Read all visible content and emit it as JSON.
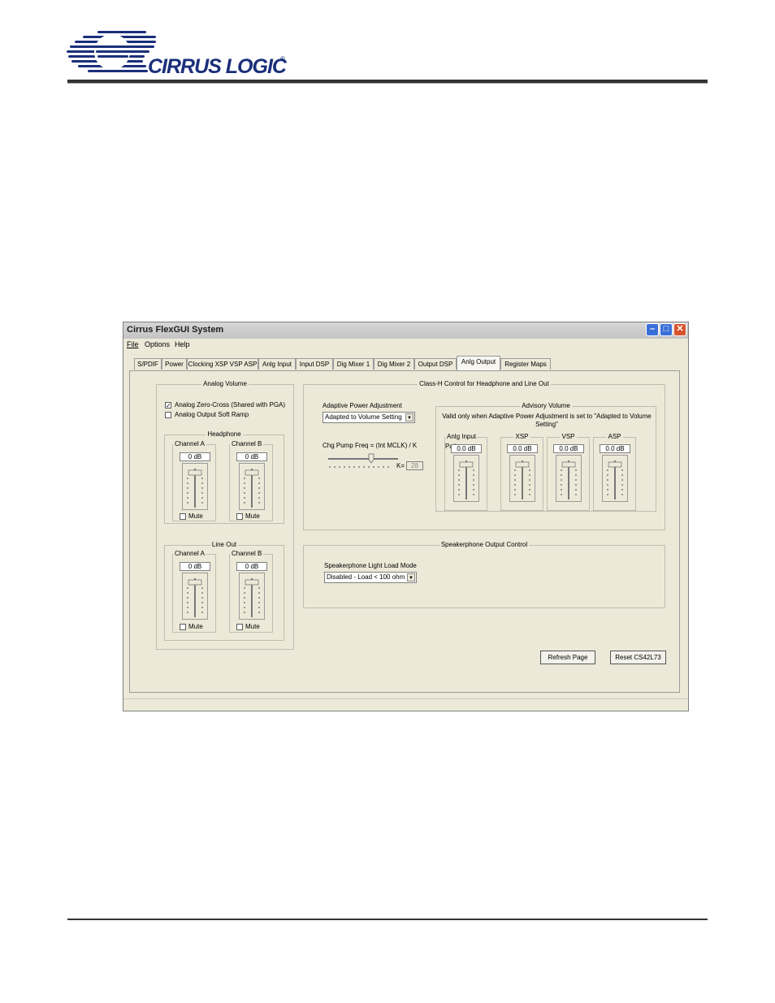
{
  "page": {
    "logo_text": "CIRRUS LOGIC",
    "logo_reg": "®"
  },
  "window": {
    "title": "Cirrus FlexGUI System",
    "menu": [
      "File",
      "Options",
      "Help"
    ],
    "tabs": [
      "S/PDIF",
      "Power",
      "Clocking XSP VSP ASP",
      "Anlg Input",
      "Input DSP",
      "Dig Mixer 1",
      "Dig Mixer 2",
      "Output DSP",
      "Anlg Output",
      "Register Maps"
    ],
    "active_tab": "Anlg Output"
  },
  "analog_volume": {
    "title": "Analog Volume",
    "zero_cross_label": "Analog Zero-Cross (Shared with PGA)",
    "zero_cross_checked": true,
    "soft_ramp_label": "Analog Output Soft Ramp",
    "soft_ramp_checked": false,
    "headphone": {
      "title": "Headphone",
      "channel_a": {
        "label": "Channel A",
        "value": "0 dB",
        "mute": "Mute"
      },
      "channel_b": {
        "label": "Channel B",
        "value": "0 dB",
        "mute": "Mute"
      }
    },
    "line_out": {
      "title": "Line Out",
      "channel_a": {
        "label": "Channel A",
        "value": "0 dB",
        "mute": "Mute"
      },
      "channel_b": {
        "label": "Channel B",
        "value": "0 dB",
        "mute": "Mute"
      }
    }
  },
  "class_h": {
    "title": "Class-H Control for Headphone and Line Out",
    "adaptive_label": "Adaptive Power Adjustment",
    "adaptive_value": "Adapted to Volume Setting",
    "pump_label": "Chg Pump Freq = (Int MCLK) / K",
    "k_label": "K=",
    "k_value": "28",
    "advisory": {
      "title": "Advisory Volume",
      "note": "Valid only when Adaptive Power Adjustment is set to \"Adapted to Volume Setting\"",
      "channels": [
        {
          "label": "Anlg Input Path",
          "value": "0.0 dB"
        },
        {
          "label": "XSP",
          "value": "0.0 dB"
        },
        {
          "label": "VSP",
          "value": "0.0 dB"
        },
        {
          "label": "ASP",
          "value": "0.0 dB"
        }
      ]
    }
  },
  "speakerphone": {
    "title": "Speakerphone Output Control",
    "mode_label": "Speakerphone Light Load Mode",
    "mode_value": "Disabled - Load < 100 ohm"
  },
  "buttons": {
    "refresh": "Refresh Page",
    "reset": "Reset CS42L73"
  }
}
